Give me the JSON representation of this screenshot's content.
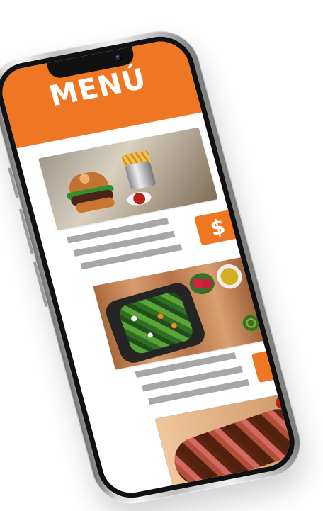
{
  "menu": {
    "title": "MENÚ",
    "items": [
      {
        "price_symbol": "$",
        "photo": "burger-photo"
      },
      {
        "price_symbol": "$",
        "photo": "salad-photo"
      },
      {
        "photo": "steak-photo"
      }
    ]
  },
  "colors": {
    "accent": "#ef7622",
    "text_lines": "#a7a7a7",
    "phone_frame": "#d9d9d9"
  }
}
